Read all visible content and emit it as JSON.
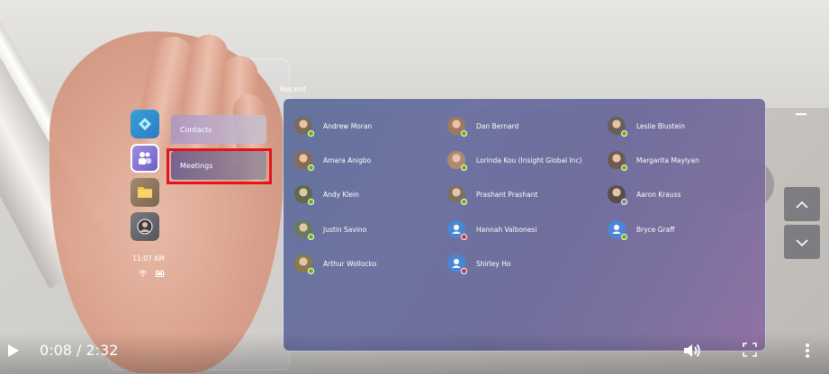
{
  "recent_section": {
    "label": "Recent",
    "contacts": [
      {
        "name": "Andrew Moran",
        "presence": "available",
        "avatar": "photo"
      },
      {
        "name": "Dan Bernard",
        "presence": "available",
        "avatar": "photo"
      },
      {
        "name": "Leslie Blustein",
        "presence": "available",
        "avatar": "photo"
      },
      {
        "name": "Amara Anigbo",
        "presence": "available",
        "avatar": "photo"
      },
      {
        "name": "Lorinda Kou (Insight Global Inc)",
        "presence": "available",
        "avatar": "photo"
      },
      {
        "name": "Margarita Maylyan",
        "presence": "available",
        "avatar": "photo"
      },
      {
        "name": "Andy Klein",
        "presence": "available",
        "avatar": "photo"
      },
      {
        "name": "Prashant Prashant",
        "presence": "available",
        "avatar": "photo"
      },
      {
        "name": "Aaron Krauss",
        "presence": "offline",
        "avatar": "photo"
      },
      {
        "name": "Justin Savino",
        "presence": "available",
        "avatar": "photo"
      },
      {
        "name": "Hannah Valbonesi",
        "presence": "busy",
        "avatar": "placeholder"
      },
      {
        "name": "Bryce Graff",
        "presence": "available",
        "avatar": "placeholder"
      },
      {
        "name": "Arthur Wollocko",
        "presence": "available",
        "avatar": "photo"
      },
      {
        "name": "Shirley Ho",
        "presence": "busy",
        "avatar": "placeholder"
      }
    ]
  },
  "menu": {
    "contacts_label": "Contacts",
    "meetings_label": "Meetings"
  },
  "app_bar": {
    "apps": [
      "app-icon",
      "teams-icon",
      "folder-icon",
      "people-icon"
    ],
    "time": "11:07 AM"
  },
  "video": {
    "timecode": "0:08 / 2:32"
  },
  "colors": {
    "highlight": "#e3141a",
    "available": "#6bb700",
    "busy": "#d13438",
    "offline": "#8a8886",
    "placeholder_avatar": "#4a86d6"
  }
}
